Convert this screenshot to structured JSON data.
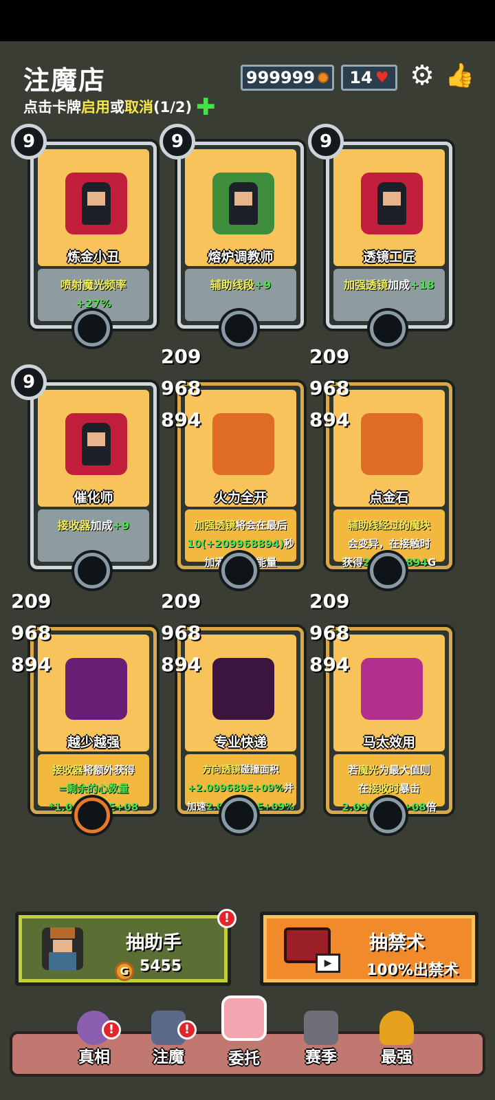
{
  "header": {
    "title": "注魔店",
    "hint_prefix": "点击卡牌",
    "hint_enable": "启用",
    "hint_or": "或",
    "hint_cancel": "取消",
    "hint_count": "(1/2)",
    "coins": "999999",
    "hearts": "14"
  },
  "cards": [
    {
      "level": "9",
      "name": "炼金小丑",
      "desc": [
        {
          "t": "喷射魔光频率",
          "c": "yl"
        },
        {
          "t": "+27%",
          "c": "g"
        }
      ]
    },
    {
      "level": "9",
      "name": "熔炉调教师",
      "desc": [
        {
          "t": "辅助线段",
          "c": "yl"
        },
        {
          "t": "+9",
          "c": "g"
        }
      ]
    },
    {
      "level": "9",
      "name": "透镜工匠",
      "desc": [
        {
          "t": "加强透镜",
          "c": "yl"
        },
        {
          "t": "加成",
          "c": "w"
        },
        {
          "t": "+18",
          "c": "g"
        }
      ]
    },
    {
      "level": "9",
      "name": "催化师",
      "desc": [
        {
          "t": "接收器",
          "c": "yl"
        },
        {
          "t": "加成",
          "c": "w"
        },
        {
          "t": "+9",
          "c": "g"
        }
      ]
    },
    {
      "level_lines": [
        "209",
        "968",
        "894"
      ],
      "name": "火力全开",
      "desc_lines": [
        [
          {
            "t": "加强透镜",
            "c": "yl"
          },
          {
            "t": "将会在最后",
            "c": "w"
          }
        ],
        [
          {
            "t": "10(+209968894)",
            "c": "g"
          },
          {
            "t": "秒",
            "c": "w"
          }
        ],
        [
          {
            "t": "加满魔光的能量",
            "c": "w"
          }
        ]
      ]
    },
    {
      "level_lines": [
        "209",
        "968",
        "894"
      ],
      "name": "点金石",
      "desc_lines": [
        [
          {
            "t": "辅助线经过的魔块",
            "c": "yl"
          }
        ],
        [
          {
            "t": "会变异，在接触时",
            "c": "w"
          }
        ],
        [
          {
            "t": "获得",
            "c": "w"
          },
          {
            "t": "209968894",
            "c": "g"
          },
          {
            "t": "G",
            "c": "w"
          }
        ]
      ]
    },
    {
      "level_lines": [
        "209",
        "968",
        "894"
      ],
      "name": "越少越强",
      "desc_lines": [
        [
          {
            "t": "接收器",
            "c": "yl"
          },
          {
            "t": "将额外获得",
            "c": "w"
          }
        ],
        [
          {
            "t": "=剩余的心数量",
            "c": "g"
          }
        ],
        [
          {
            "t": "*1.049844E+08",
            "c": "g"
          }
        ]
      ]
    },
    {
      "level_lines": [
        "209",
        "968",
        "894"
      ],
      "name": "专业快递",
      "desc_lines": [
        [
          {
            "t": "方向透镜",
            "c": "yl"
          },
          {
            "t": "碰撞面积",
            "c": "w"
          }
        ],
        [
          {
            "t": "+2.099689E+09%",
            "c": "g"
          },
          {
            "t": "并",
            "c": "w"
          }
        ],
        [
          {
            "t": "加速",
            "c": "w"
          },
          {
            "t": "2.099689E+09%",
            "c": "g"
          }
        ]
      ]
    },
    {
      "level_lines": [
        "209",
        "968",
        "894"
      ],
      "name": "马太效用",
      "desc_lines": [
        [
          {
            "t": "若",
            "c": "w"
          },
          {
            "t": "魔光",
            "c": "yl"
          },
          {
            "t": "为最大值则",
            "c": "w"
          }
        ],
        [
          {
            "t": "在",
            "c": "w"
          },
          {
            "t": "接收时",
            "c": "yl"
          },
          {
            "t": "暴击",
            "c": "w"
          }
        ],
        [
          {
            "t": "2.099689E+08",
            "c": "g"
          },
          {
            "t": "倍",
            "c": "w"
          }
        ]
      ]
    }
  ],
  "draw": {
    "helper_label": "抽助手",
    "helper_cost": "5455",
    "forbid_label": "抽禁术",
    "forbid_sub": "100%出禁术",
    "alert": "!"
  },
  "nav": [
    {
      "label": "真相",
      "icon": "crystal-ball-icon"
    },
    {
      "label": "注魔",
      "icon": "castle-icon"
    },
    {
      "label": "委托",
      "icon": "paw-icon"
    },
    {
      "label": "赛季",
      "icon": "wolf-icon"
    },
    {
      "label": "最强",
      "icon": "trophy-icon"
    }
  ]
}
